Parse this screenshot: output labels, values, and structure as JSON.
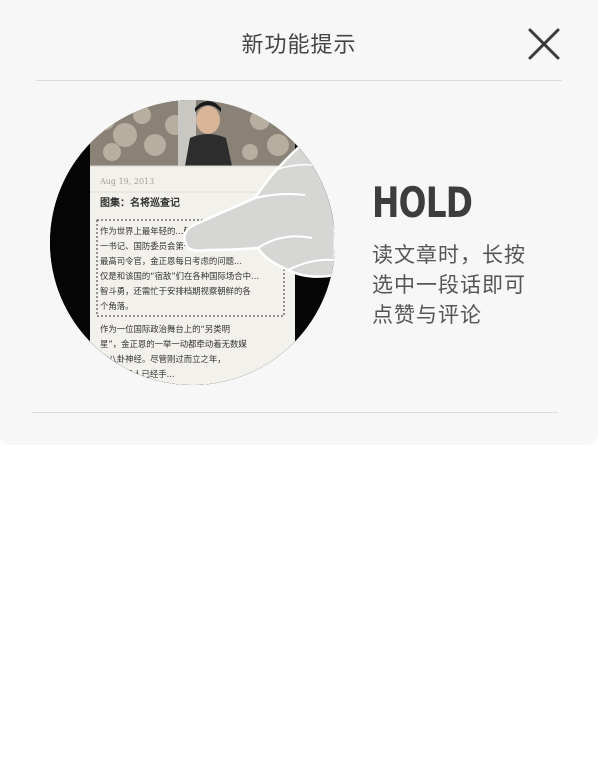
{
  "header": {
    "title": "新功能提示"
  },
  "illustration": {
    "article_date": "Aug 19, 2013",
    "article_headline": "图集：名将巡查记",
    "highlighted_lines": [
      "作为世界上最年轻的...朝鲜劳...",
      "一书记、国防委员会第一委员长兼...",
      "最高司令官，金正恩每日考虑的问题...",
      "仅是和该国的“宿敌”们在各种国际场合中...",
      "智斗勇，还需忙于安排档期视察朝鲜的各",
      "个角落。"
    ],
    "body_lines": [
      "作为一位国际政治舞台上的“另类明",
      "星”，金正恩的一举一动都牵动着无数媒",
      "体八卦神经。尽管刚过而立之年，",
      "...高领导人已经手..."
    ],
    "icon": "long-press-hand-icon"
  },
  "tip": {
    "heading": "HOLD",
    "lines": [
      "读文章时，长按",
      "选中一段话即可",
      "点赞与评论"
    ]
  },
  "colors": {
    "card_background": "#f7f7f7",
    "title_text": "#444444",
    "divider": "#dcdcdc",
    "heading": "#3d3d3d",
    "body_text": "#555555"
  }
}
